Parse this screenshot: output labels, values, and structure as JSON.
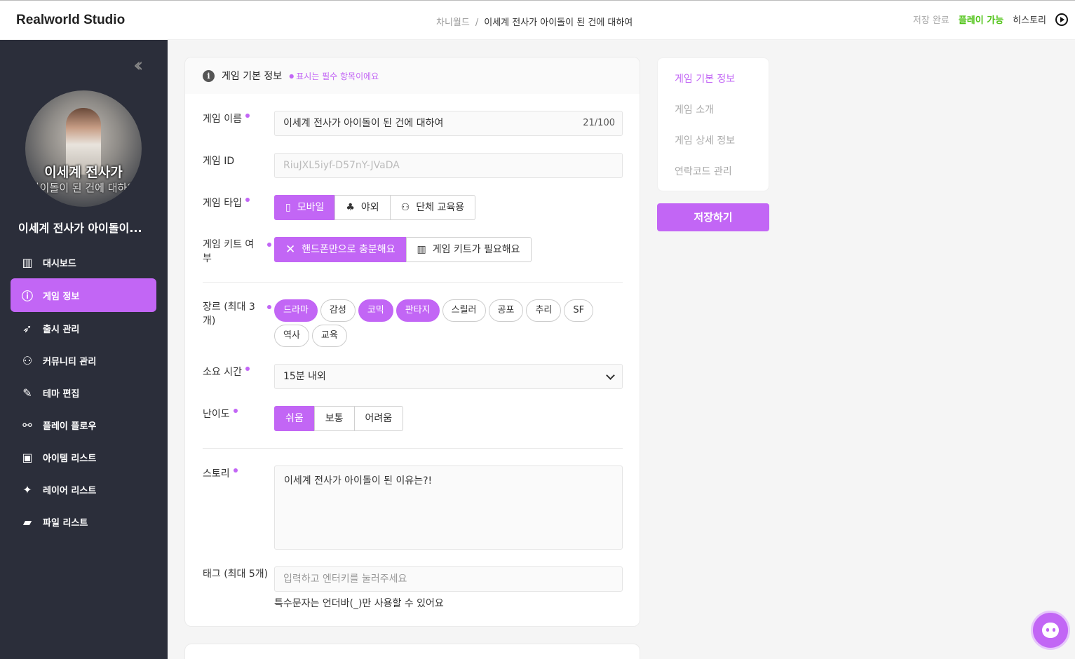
{
  "app": {
    "logo": "Realworld Studio"
  },
  "breadcrumb": {
    "parent": "차니월드",
    "separator": "/",
    "current": "이세계 전사가 아이돌이 된 건에 대하여"
  },
  "header": {
    "save_status": "저장 완료",
    "play_status": "플레이 가능",
    "history_label": "히스토리"
  },
  "sidebar": {
    "avatar_caption_line1": "이세계 전사가",
    "avatar_caption_line2": "아이돌이 된 건에 대하여",
    "game_name": "이세계 전사가 아이돌이...",
    "items": [
      {
        "label": "대시보드",
        "icon": "chart-icon"
      },
      {
        "label": "게임 정보",
        "icon": "info-icon",
        "active": true
      },
      {
        "label": "출시 관리",
        "icon": "rocket-icon"
      },
      {
        "label": "커뮤니티 관리",
        "icon": "users-icon"
      },
      {
        "label": "테마 편집",
        "icon": "brush-icon"
      },
      {
        "label": "플레이 플로우",
        "icon": "flow-icon"
      },
      {
        "label": "아이템 리스트",
        "icon": "gift-icon"
      },
      {
        "label": "레이어 리스트",
        "icon": "sparkles-icon"
      },
      {
        "label": "파일 리스트",
        "icon": "folder-icon"
      }
    ]
  },
  "form": {
    "section_title": "게임 기본 정보",
    "required_note": "표시는 필수 항목이에요",
    "name": {
      "label": "게임 이름",
      "value": "이세계 전사가 아이돌이 된 건에 대하여",
      "count": "21/100"
    },
    "id": {
      "label": "게임 ID",
      "value": "RiuJXL5iyf-D57nY-JVaDA"
    },
    "type": {
      "label": "게임 타입",
      "options": [
        "모바일",
        "야외",
        "단체 교육용"
      ],
      "selected": "모바일"
    },
    "kit": {
      "label": "게임 키트 여부",
      "options": [
        "핸드폰만으로 충분해요",
        "게임 키트가 필요해요"
      ],
      "selected": "핸드폰만으로 충분해요"
    },
    "genre": {
      "label": "장르 (최대 3개)",
      "chips": [
        {
          "label": "드라마",
          "on": true
        },
        {
          "label": "감성",
          "on": false
        },
        {
          "label": "코믹",
          "on": true
        },
        {
          "label": "판타지",
          "on": true
        },
        {
          "label": "스릴러",
          "on": false
        },
        {
          "label": "공포",
          "on": false
        },
        {
          "label": "추리",
          "on": false
        },
        {
          "label": "SF",
          "on": false
        },
        {
          "label": "역사",
          "on": false
        },
        {
          "label": "교육",
          "on": false
        }
      ]
    },
    "duration": {
      "label": "소요 시간",
      "value": "15분 내외"
    },
    "difficulty": {
      "label": "난이도",
      "options": [
        "쉬움",
        "보통",
        "어려움"
      ],
      "selected": "쉬움"
    },
    "story": {
      "label": "스토리",
      "value": "이세계 전사가 아이돌이 된 이유는?!"
    },
    "tags": {
      "label": "태그 (최대 5개)",
      "placeholder": "입력하고 엔터키를 눌러주세요",
      "hint": "특수문자는 언더바(_)만 사용할 수 있어요"
    }
  },
  "toc": {
    "items": [
      "게임 기본 정보",
      "게임 소개",
      "게임 상세 정보",
      "연락코드 관리"
    ],
    "active": "게임 기본 정보"
  },
  "save_button": "저장하기",
  "colors": {
    "accent": "#c266f5",
    "sidebar_bg": "#2b2e3a",
    "play_green": "#52c41a"
  }
}
